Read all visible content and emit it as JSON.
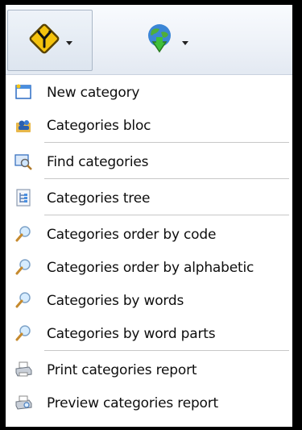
{
  "toolbar": {
    "buttons": [
      {
        "icon": "road-junction-sign-icon",
        "has_dropdown": true,
        "pressed": true
      },
      {
        "icon": "globe-download-icon",
        "has_dropdown": true,
        "pressed": false
      }
    ]
  },
  "menu": {
    "groups": [
      [
        {
          "label": "New category",
          "icon": "new-window-icon"
        },
        {
          "label": "Categories bloc",
          "icon": "users-folder-icon"
        }
      ],
      [
        {
          "label": "Find categories",
          "icon": "find-window-icon"
        }
      ],
      [
        {
          "label": "Categories tree",
          "icon": "tree-document-icon"
        }
      ],
      [
        {
          "label": "Categories order by code",
          "icon": "magnifier-icon"
        },
        {
          "label": "Categories order by alphabetic",
          "icon": "magnifier-icon"
        },
        {
          "label": "Categories by words",
          "icon": "magnifier-icon"
        },
        {
          "label": "Categories by word parts",
          "icon": "magnifier-icon"
        }
      ],
      [
        {
          "label": "Print categories report",
          "icon": "printer-icon"
        },
        {
          "label": "Preview categories report",
          "icon": "print-preview-icon"
        }
      ]
    ]
  },
  "colors": {
    "frame_border": "#000000",
    "menu_text": "#0e0e0e",
    "toolbar_bg": "#eef2f8",
    "separator": "#c7c7c7"
  }
}
